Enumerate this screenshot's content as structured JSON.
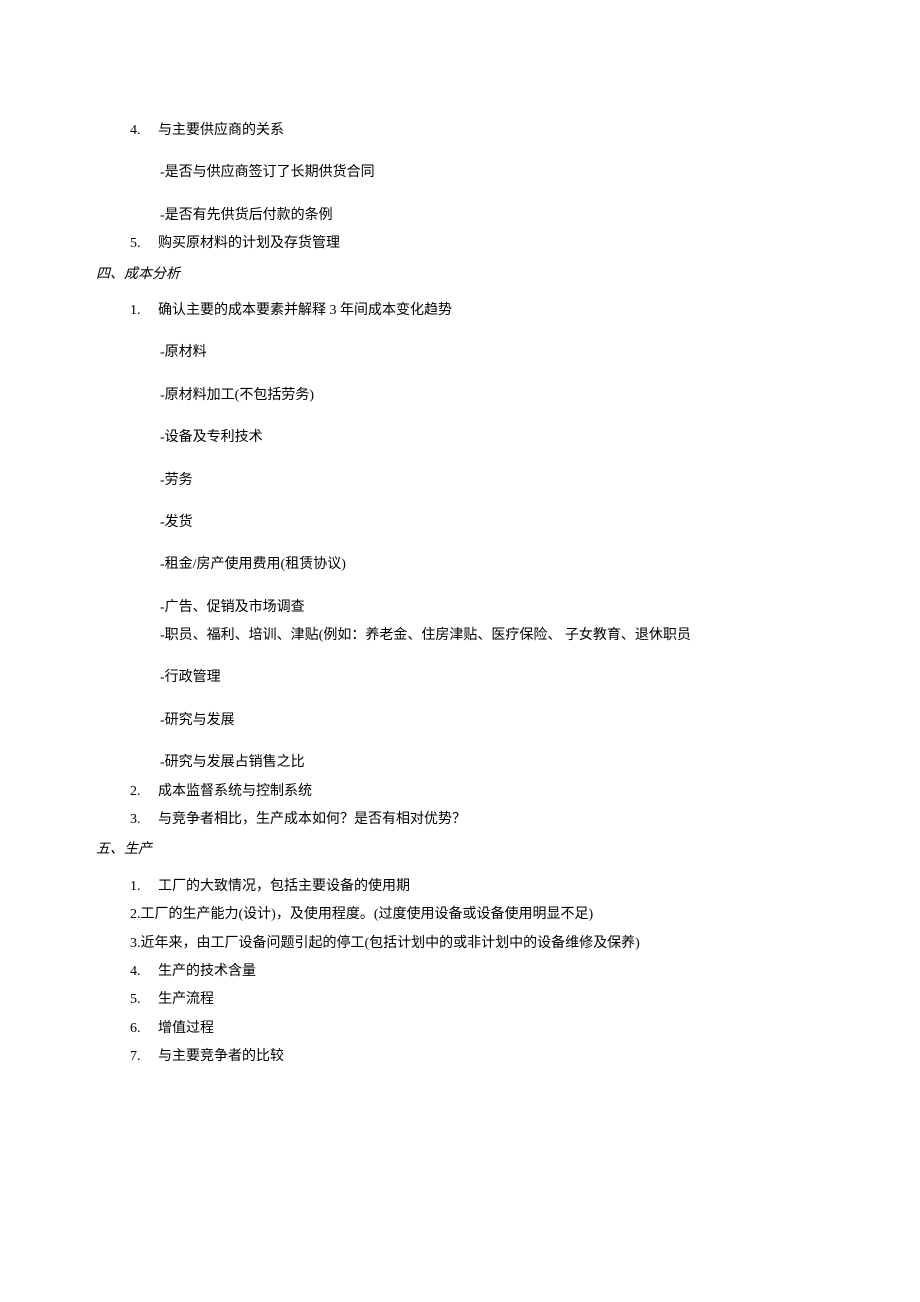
{
  "sec3": {
    "item4": {
      "num": "4.",
      "text": "与主要供应商的关系",
      "sub1": "-是否与供应商签订了长期供货合同",
      "sub2": "-是否有先供货后付款的条例"
    },
    "item5": {
      "num": "5.",
      "text": "购买原材料的计划及存货管理"
    }
  },
  "sec4": {
    "title": "四、成本分析",
    "item1": {
      "num": "1.",
      "text": "确认主要的成本要素并解释 3 年间成本变化趋势",
      "s1": "-原材料",
      "s2": "-原材料加工(不包括劳务)",
      "s3": "-设备及专利技术",
      "s4": "-劳务",
      "s5": "-发货",
      "s6": "-租金/房产使用费用(租赁协议)",
      "s7": "-广告、促销及市场调查",
      "s8": "-职员、福利、培训、津贴(例如：养老金、住房津贴、医疗保险、 子女教育、退休职员",
      "s9": "-行政管理",
      "s10": "-研究与发展",
      "s11": "-研究与发展占销售之比"
    },
    "item2": {
      "num": "2.",
      "text": "成本监督系统与控制系统"
    },
    "item3": {
      "num": "3.",
      "text": "与竞争者相比，生产成本如何？是否有相对优势？"
    }
  },
  "sec5": {
    "title": "五、生产",
    "item1": {
      "num": "1.",
      "text": "工厂的大致情况，包括主要设备的使用期"
    },
    "item2": {
      "text": "2.工厂的生产能力(设计)，及使用程度。(过度使用设备或设备使用明显不足)"
    },
    "item3": {
      "text": "3.近年来，由工厂设备问题引起的停工(包括计划中的或非计划中的设备维修及保养)"
    },
    "item4": {
      "num": "4.",
      "text": "生产的技术含量"
    },
    "item5": {
      "num": "5.",
      "text": "生产流程"
    },
    "item6": {
      "num": "6.",
      "text": "增值过程"
    },
    "item7": {
      "num": "7.",
      "text": "与主要竞争者的比较"
    }
  }
}
